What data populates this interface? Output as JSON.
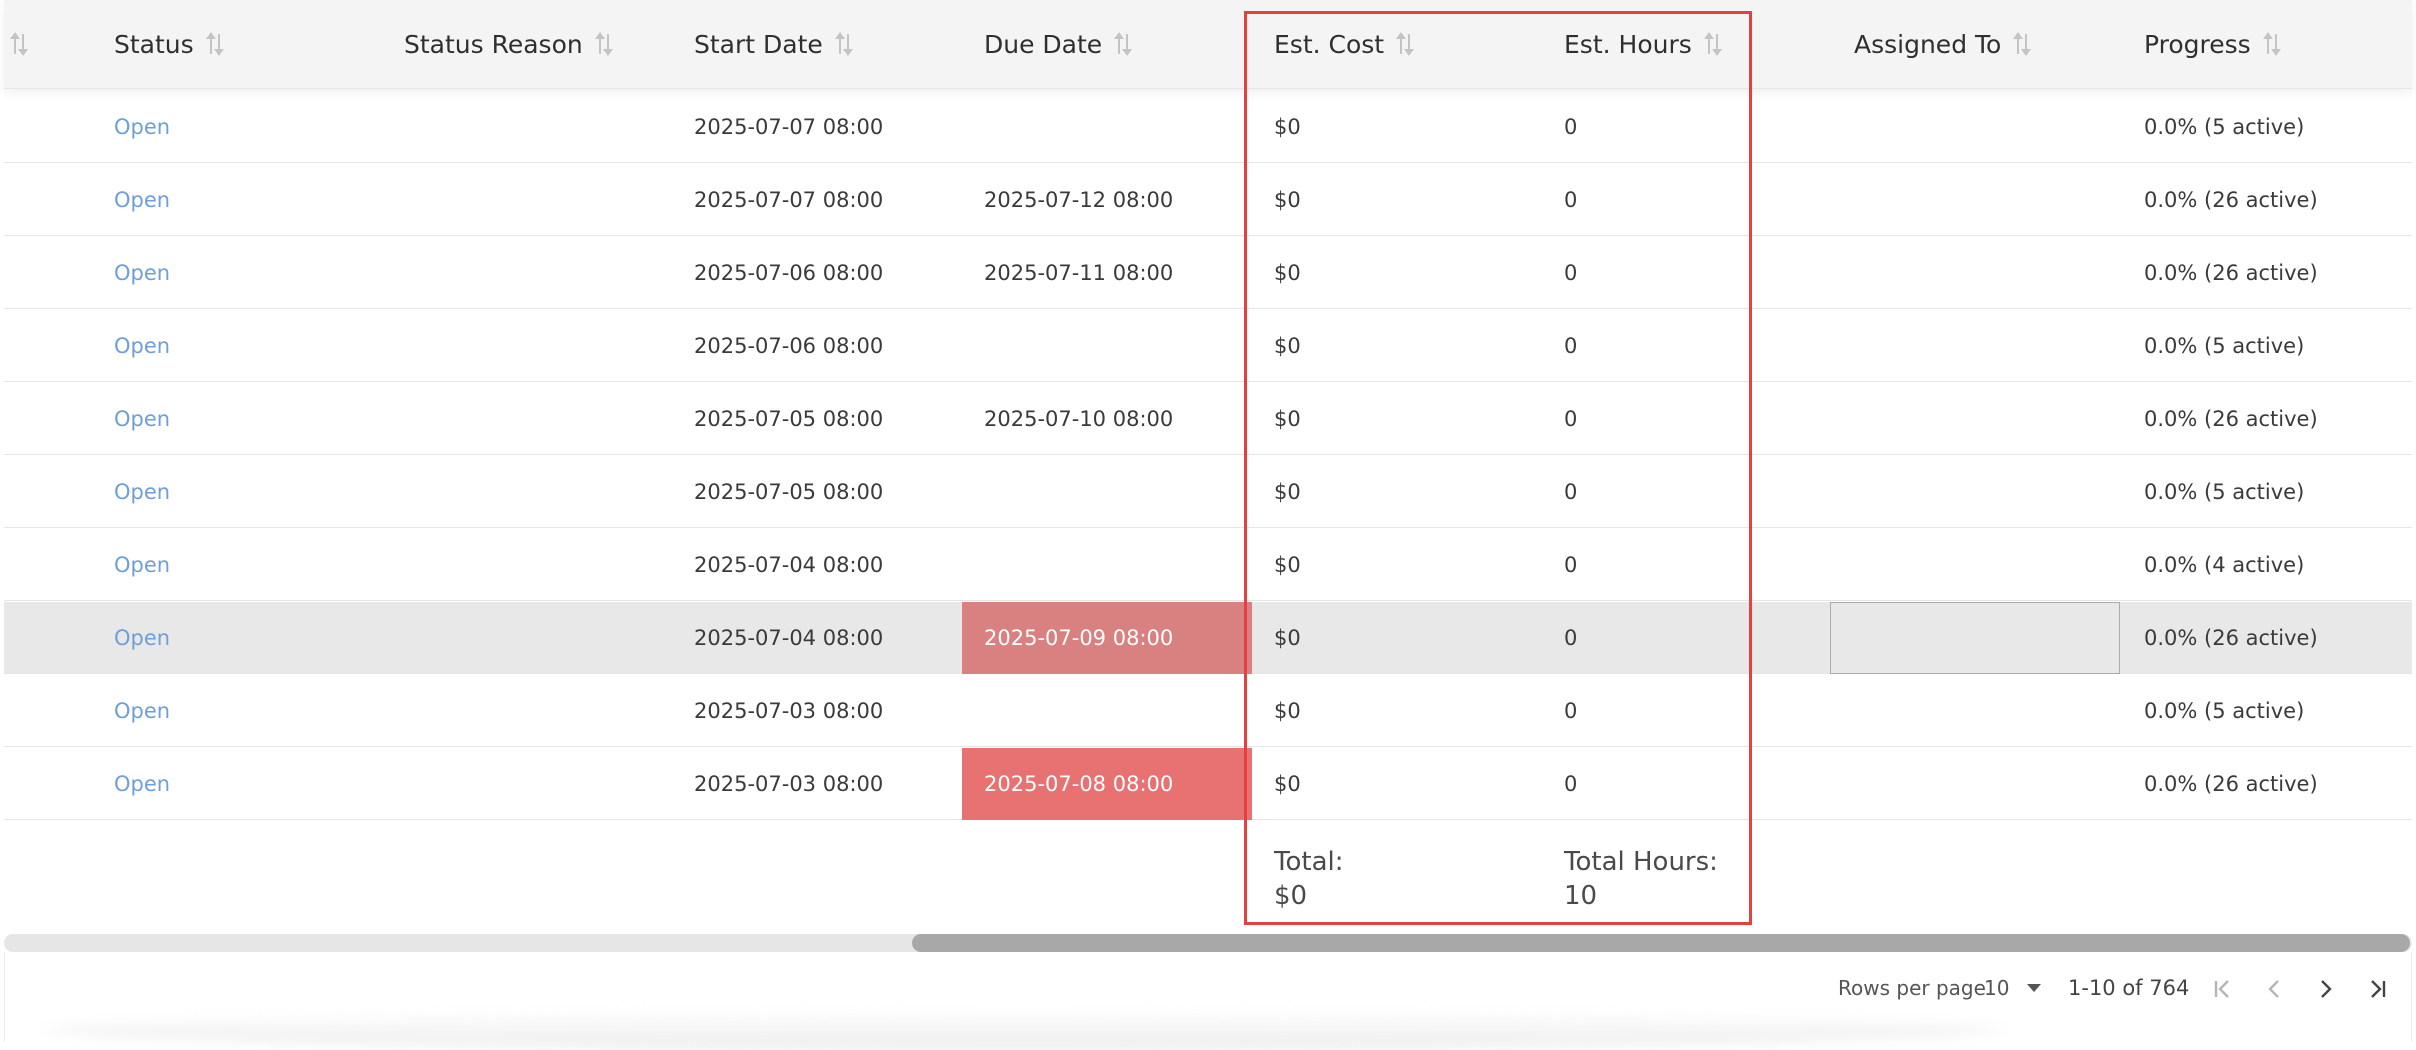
{
  "columns": {
    "sort": "",
    "status": "Status",
    "status_reason": "Status Reason",
    "start_date": "Start Date",
    "due_date": "Due Date",
    "est_cost": "Est. Cost",
    "est_hours": "Est. Hours",
    "assigned_to": "Assigned To",
    "progress": "Progress"
  },
  "rows": [
    {
      "status": "Open",
      "status_reason": "",
      "start_date": "2025-07-07 08:00",
      "due_date": "",
      "est_cost": "$0",
      "est_hours": "0",
      "assigned_to": "",
      "progress": "0.0% (5 active)"
    },
    {
      "status": "Open",
      "status_reason": "",
      "start_date": "2025-07-07 08:00",
      "due_date": "2025-07-12 08:00",
      "est_cost": "$0",
      "est_hours": "0",
      "assigned_to": "",
      "progress": "0.0% (26 active)"
    },
    {
      "status": "Open",
      "status_reason": "",
      "start_date": "2025-07-06 08:00",
      "due_date": "2025-07-11 08:00",
      "est_cost": "$0",
      "est_hours": "0",
      "assigned_to": "",
      "progress": "0.0% (26 active)"
    },
    {
      "status": "Open",
      "status_reason": "",
      "start_date": "2025-07-06 08:00",
      "due_date": "",
      "est_cost": "$0",
      "est_hours": "0",
      "assigned_to": "",
      "progress": "0.0% (5 active)"
    },
    {
      "status": "Open",
      "status_reason": "",
      "start_date": "2025-07-05 08:00",
      "due_date": "2025-07-10 08:00",
      "est_cost": "$0",
      "est_hours": "0",
      "assigned_to": "",
      "progress": "0.0% (26 active)"
    },
    {
      "status": "Open",
      "status_reason": "",
      "start_date": "2025-07-05 08:00",
      "due_date": "",
      "est_cost": "$0",
      "est_hours": "0",
      "assigned_to": "",
      "progress": "0.0% (5 active)"
    },
    {
      "status": "Open",
      "status_reason": "",
      "start_date": "2025-07-04 08:00",
      "due_date": "",
      "est_cost": "$0",
      "est_hours": "0",
      "assigned_to": "",
      "progress": "0.0% (4 active)"
    },
    {
      "status": "Open",
      "status_reason": "",
      "start_date": "2025-07-04 08:00",
      "due_date": "2025-07-09 08:00",
      "est_cost": "$0",
      "est_hours": "0",
      "assigned_to": "",
      "progress": "0.0% (26 active)"
    },
    {
      "status": "Open",
      "status_reason": "",
      "start_date": "2025-07-03 08:00",
      "due_date": "",
      "est_cost": "$0",
      "est_hours": "0",
      "assigned_to": "",
      "progress": "0.0% (5 active)"
    },
    {
      "status": "Open",
      "status_reason": "",
      "start_date": "2025-07-03 08:00",
      "due_date": "2025-07-08 08:00",
      "est_cost": "$0",
      "est_hours": "0",
      "assigned_to": "",
      "progress": "0.0% (26 active)"
    }
  ],
  "totals": {
    "cost_label": "Total:",
    "cost_value": "$0",
    "hours_label": "Total Hours:",
    "hours_value": "10"
  },
  "pagination": {
    "rows_per_page_label": "Rows per page",
    "rows_per_page": "10",
    "range": "1-10 of 764",
    "icons": [
      "first-page-icon",
      "prev-page-icon",
      "next-page-icon",
      "last-page-icon"
    ]
  },
  "colors": {
    "status_link": "#6f9fd8",
    "overdue_highlight": "#e87272",
    "selected_row": "#e8e8e8",
    "annotation_box": "#e54040"
  }
}
